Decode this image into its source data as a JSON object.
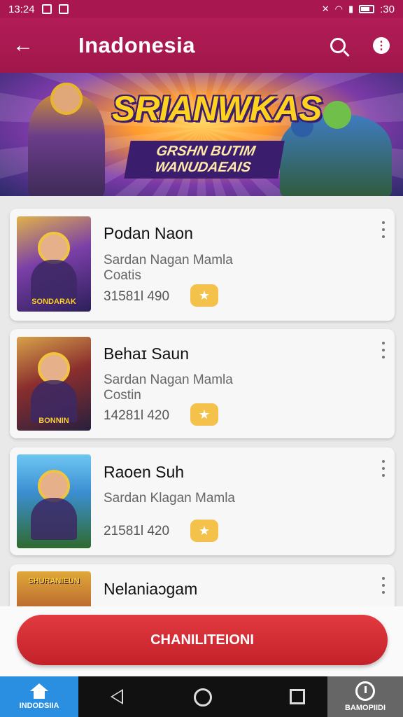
{
  "status_bar": {
    "time": "13:24",
    "battery_text": ":30",
    "icons": [
      "image-icon",
      "notification-icon",
      "bluetooth-icon",
      "wifi-icon",
      "signal-icon",
      "battery-icon"
    ]
  },
  "app_bar": {
    "title": "Inadonesia",
    "back_icon": "back-arrow-icon",
    "search_icon": "search-icon",
    "more_icon": "info-icon"
  },
  "banner": {
    "title": "SRIANWKAS",
    "subtitle": "GRSHN BUTIM WANUDAEAIS"
  },
  "games": [
    {
      "title": "Podan Naon",
      "subtitle": "Sardan Nagan Mamla",
      "subtitle2": "Coatis",
      "stats": "31581l  490",
      "thumb_caption": "SONDARAK"
    },
    {
      "title": "Behaɪ Saun",
      "subtitle": "Sardan Nagan Mamla",
      "subtitle2": "Costin",
      "stats": "14281l  420",
      "thumb_caption": "BONNIN"
    },
    {
      "title": "Raoen Suh",
      "subtitle": "Sardan Klagan Mamla",
      "subtitle2": "",
      "stats": "21581l  420",
      "thumb_caption": ""
    },
    {
      "title": "Nelaniaɔgam",
      "subtitle": "",
      "subtitle2": "",
      "stats": "",
      "thumb_caption": "SHURANIEUN"
    }
  ],
  "cta": {
    "label": "CHANILITEIONI"
  },
  "bottom_nav": {
    "home_label": "INDODSIIA",
    "right_label": "BAMOPIIDI"
  },
  "colors": {
    "app_bar": "#a8174f",
    "cta": "#d2282f",
    "star": "#f4c24a",
    "nav_home": "#2a8fe0"
  }
}
